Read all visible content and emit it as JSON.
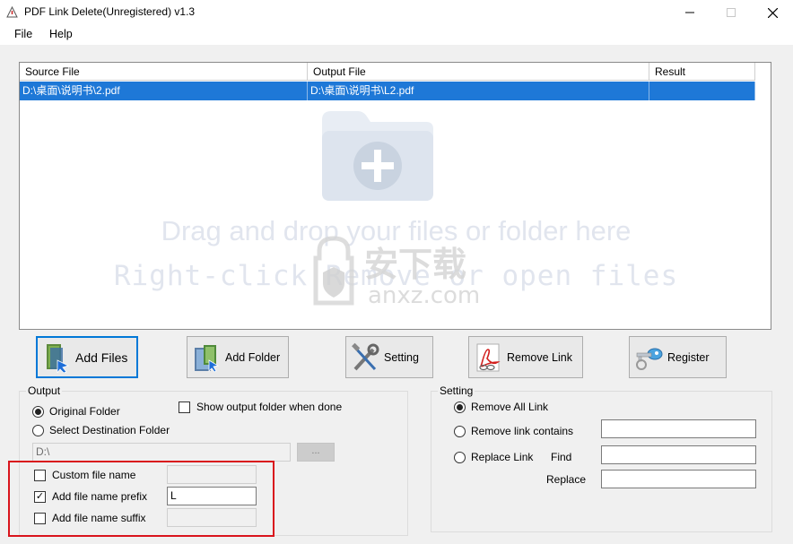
{
  "window": {
    "title": "PDF Link Delete(Unregistered) v1.3"
  },
  "menu": {
    "file": "File",
    "help": "Help"
  },
  "table": {
    "headers": [
      "Source File",
      "Output File",
      "Result"
    ],
    "rows": [
      {
        "source": "D:\\桌面\\说明书\\2.pdf",
        "output": "D:\\桌面\\说明书\\L2.pdf",
        "result": ""
      }
    ],
    "drop_hint_1": "Drag and drop your files or folder here",
    "drop_hint_2": "Right-click Remove or open files",
    "watermark": "安下载 anxz.com"
  },
  "toolbar": {
    "add_files": "Add Files",
    "add_folder": "Add Folder",
    "setting": "Setting",
    "remove_link": "Remove Link",
    "register": "Register"
  },
  "output": {
    "legend": "Output",
    "original_folder": "Original Folder",
    "select_destination": "Select Destination Folder",
    "show_output_folder": "Show output folder when done",
    "destination_value": "D:\\",
    "browse": "...",
    "custom_file_name": "Custom file name",
    "add_prefix": "Add file name prefix",
    "prefix_value": "L",
    "add_suffix": "Add file name suffix"
  },
  "setting": {
    "legend": "Setting",
    "remove_all": "Remove All Link",
    "remove_contains": "Remove link contains",
    "replace_link": "Replace Link",
    "find": "Find",
    "replace": "Replace"
  },
  "colors": {
    "selection": "#1e78d7",
    "highlight_box": "#d9141c",
    "focus_border": "#0078d7"
  }
}
